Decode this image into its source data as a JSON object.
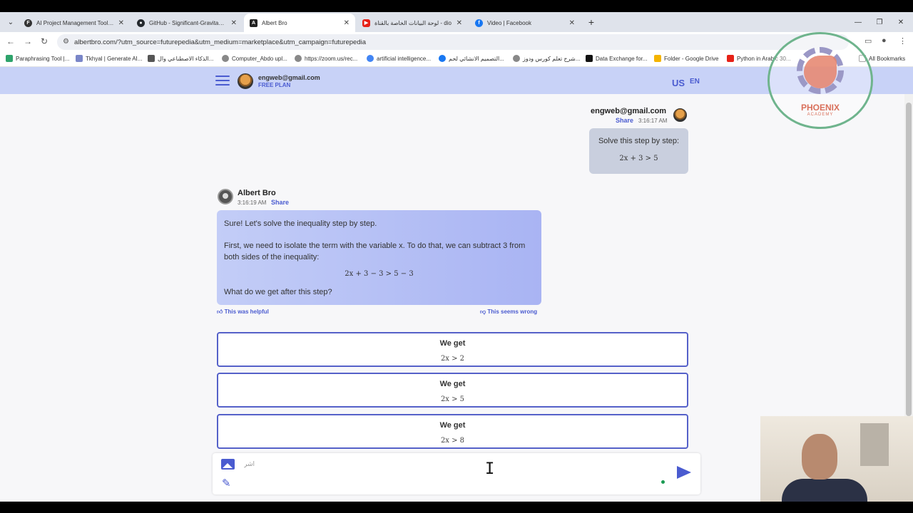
{
  "browser": {
    "tabs": [
      {
        "title": "AI Project Management Tools &",
        "color": "#333333"
      },
      {
        "title": "GitHub - Significant-Gravitas/A",
        "color": "#24292e"
      },
      {
        "title": "Albert Bro",
        "color": "#222222"
      },
      {
        "title": "لوحة البيانات الخاصة بالقناة - dio",
        "color": "#e62117"
      },
      {
        "title": "Video | Facebook",
        "color": "#1877f2"
      }
    ],
    "url": "albertbro.com/?utm_source=futurepedia&utm_medium=marketplace&utm_campaign=futurepedia",
    "bookmarks": [
      "Paraphrasing Tool |...",
      "Tkhyal | Generate AI...",
      "الذكاء الاصطناعي وال...",
      "Computer_Abdo upl...",
      "https://zoom.us/rec...",
      "artificial intelligence...",
      "التصميم الانشائي لحم...",
      "شرح تعلم كورس ودوز...",
      "Data Exchange for...",
      "Folder - Google Drive",
      "Python in Arabic 30..."
    ],
    "all_bookmarks": "All Bookmarks"
  },
  "header": {
    "email": "engweb@gmail.com",
    "plan": "FREE PLAN",
    "country": "US",
    "language": "EN"
  },
  "user_message": {
    "name": "engweb@gmail.com",
    "share": "Share",
    "time": "3:16:17 AM",
    "text": "Solve this step by step:",
    "math": "2x + 3 > 5"
  },
  "bot_message": {
    "name": "Albert Bro",
    "time": "3:16:19 AM",
    "share": "Share",
    "p1": "Sure! Let's solve the inequality step by step.",
    "p2": "First, we need to isolate the term with the variable x. To do that, we can subtract 3 from both sides of the inequality:",
    "math": "2x + 3 − 3 > 5 − 3",
    "p3": "What do we get after this step?",
    "helpful": "This was helpful",
    "wrong": "This seems wrong"
  },
  "options": [
    {
      "label": "We get",
      "math": "2x > 2"
    },
    {
      "label": "We get",
      "math": "2x > 5"
    },
    {
      "label": "We get",
      "math": "2x > 8"
    }
  ],
  "composer": {
    "placeholder": "أشر"
  },
  "logo": {
    "name": "PHOENIX",
    "sub": "ACADEMY"
  }
}
